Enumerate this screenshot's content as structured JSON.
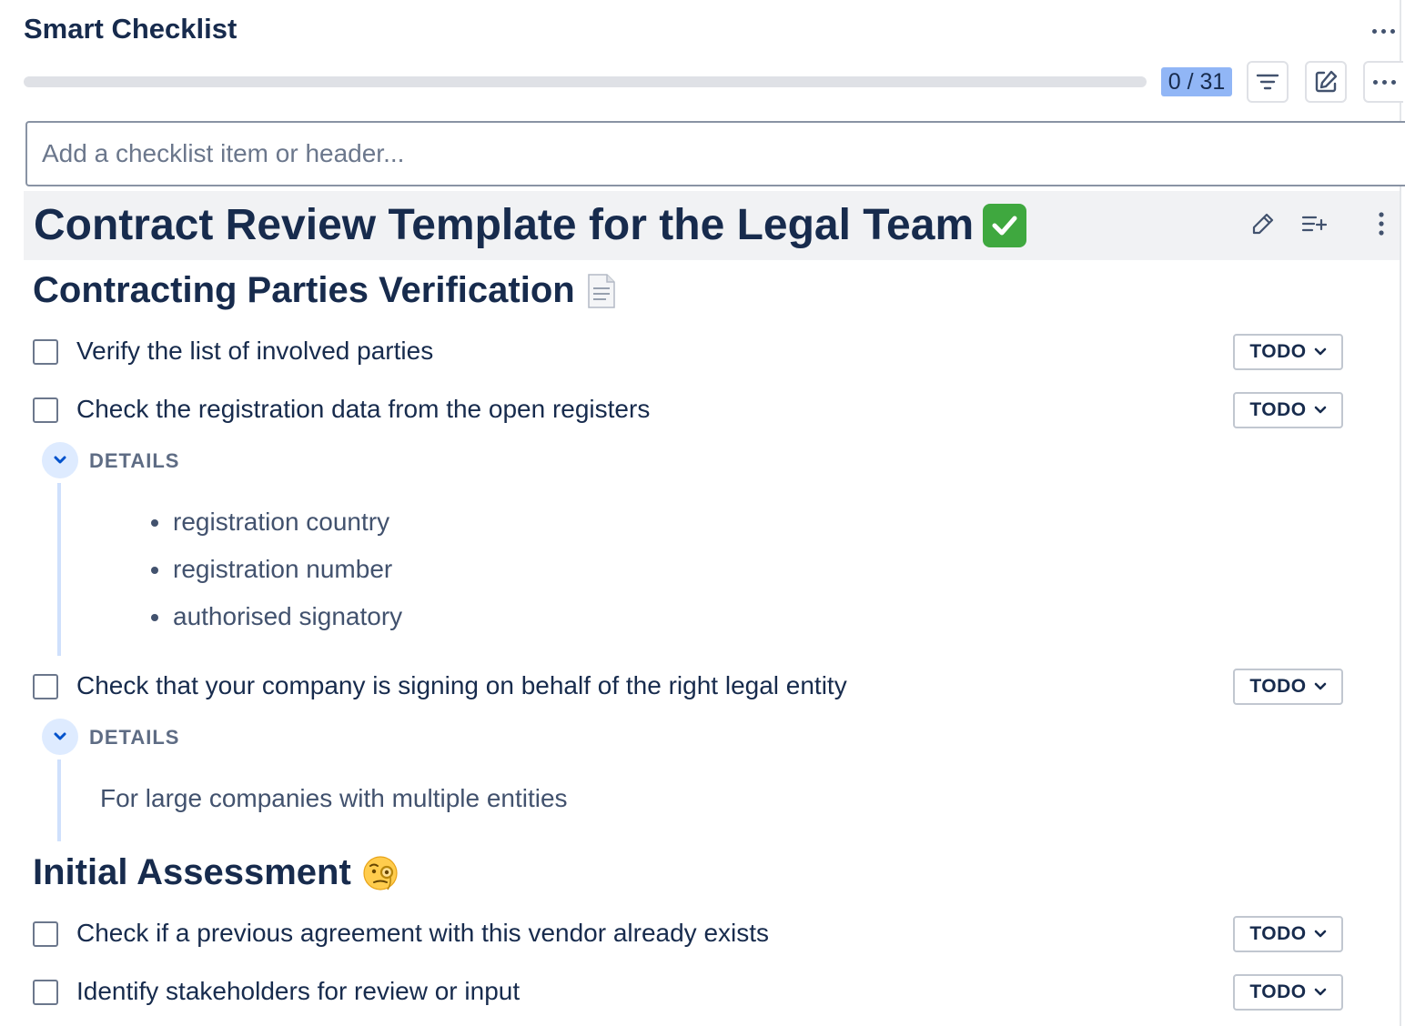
{
  "app": {
    "title": "Smart Checklist"
  },
  "progress": {
    "done": 0,
    "total": 31,
    "counter_text": "0 / 31",
    "fraction": 0
  },
  "add_item": {
    "placeholder": "Add a checklist item or header..."
  },
  "template": {
    "title": "Contract Review Template for the Legal Team"
  },
  "sections": [
    {
      "title": "Contracting Parties Verification",
      "icon": "document-icon"
    },
    {
      "title": "Initial Assessment",
      "icon": "monocle-face-icon"
    }
  ],
  "items": [
    {
      "text": "Verify the list of involved parties",
      "status": "TODO",
      "checked": false
    },
    {
      "text": "Check the registration data from the open registers",
      "status": "TODO",
      "checked": false
    },
    {
      "text": "Check that your company is signing on behalf of the right legal entity",
      "status": "TODO",
      "checked": false
    },
    {
      "text": "Check if a previous agreement with this vendor already exists",
      "status": "TODO",
      "checked": false
    },
    {
      "text": "Identify stakeholders for review or input",
      "status": "TODO",
      "checked": false
    }
  ],
  "details": [
    {
      "label": "DETAILS",
      "bullets": [
        "registration country",
        "registration number",
        "authorised signatory"
      ]
    },
    {
      "label": "DETAILS",
      "text": "For large companies with multiple entities"
    }
  ],
  "colors": {
    "accent": "#0052cc",
    "counter_bg": "#91b6f6",
    "text": "#172b4d",
    "success": "#3fa83f"
  }
}
